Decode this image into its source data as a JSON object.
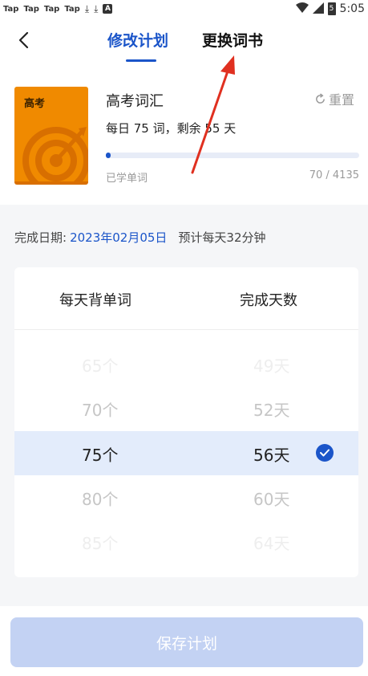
{
  "status_bar": {
    "notifications": [
      "Tap",
      "Tap",
      "Tap",
      "Tap"
    ],
    "time": "5:05",
    "battery_label": "5"
  },
  "nav": {
    "tab_active": "修改计划",
    "tab_inactive": "更换词书"
  },
  "book": {
    "cover_title": "高考",
    "name": "高考词汇",
    "reset_label": "重置",
    "plan_text": "每日 75 词，剩余 55 天",
    "progress_label": "已学单词",
    "progress_count": "70 / 4135",
    "progress_fraction": 0.017
  },
  "finish": {
    "label": "完成日期:",
    "date": "2023年02月05日",
    "estimate": "预计每天32分钟"
  },
  "picker": {
    "col_words": "每天背单词",
    "col_days": "完成天数",
    "rows": [
      {
        "words": "65个",
        "days": "49天"
      },
      {
        "words": "70个",
        "days": "52天"
      },
      {
        "words": "75个",
        "days": "56天"
      },
      {
        "words": "80个",
        "days": "60天"
      },
      {
        "words": "85个",
        "days": "64天"
      }
    ]
  },
  "save_label": "保存计划",
  "colors": {
    "accent": "#1b55c9",
    "book_cover": "#f08a00",
    "selected_row": "#e3ecfb",
    "save_button_disabled": "#c3d2f3",
    "annotation_arrow": "#e03020"
  }
}
